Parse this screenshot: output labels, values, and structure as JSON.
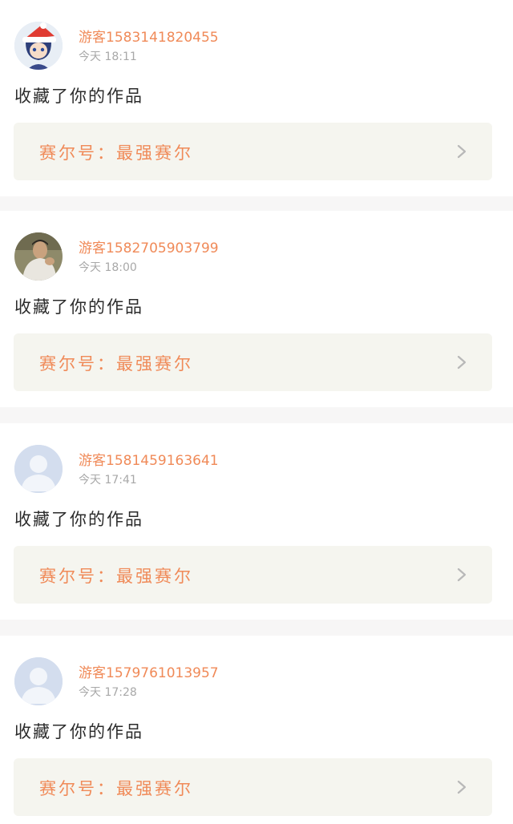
{
  "notifications": [
    {
      "username": "游客1583141820455",
      "time": "今天  18:11",
      "action": "收藏了你的作品",
      "work_title": "赛尔号：最强赛尔",
      "avatar": "anime-santa-hat-avatar"
    },
    {
      "username": "游客1582705903799",
      "time": "今天  18:00",
      "action": "收藏了你的作品",
      "work_title": "赛尔号：最强赛尔",
      "avatar": "photo-person-avatar"
    },
    {
      "username": "游客1581459163641",
      "time": "今天  17:41",
      "action": "收藏了你的作品",
      "work_title": "赛尔号：最强赛尔",
      "avatar": "default-user-avatar"
    },
    {
      "username": "游客1579761013957",
      "time": "今天  17:28",
      "action": "收藏了你的作品",
      "work_title": "赛尔号：最强赛尔",
      "avatar": "default-user-avatar"
    }
  ],
  "colors": {
    "accent": "#f08a58",
    "time_gray": "#a8a8a8",
    "box_bg": "#f5f5ef",
    "separator": "#f7f6f6"
  }
}
